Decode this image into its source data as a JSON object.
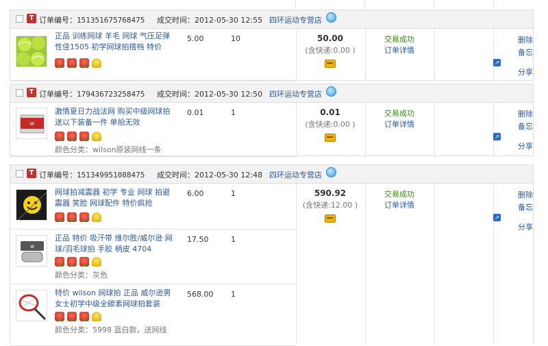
{
  "orders": [
    {
      "order_label": "订单编号：",
      "order_no": "151351675768475",
      "date_label": "成交时间：",
      "date": "2012-05-30 12:55",
      "shop": "四环运动专营店",
      "total": "50.00",
      "shipping": "(含快递:0.00 )",
      "status": "交易成功",
      "detail": "订单详情",
      "actions": {
        "delete": "删除",
        "memo": "备忘",
        "share": "分享"
      },
      "items": [
        {
          "title": "正品 训练网球 羊毛 网球 气压足弹性佳1505 初学网球拍搭档 特价",
          "price": "5.00",
          "qty": "10",
          "color": ""
        }
      ]
    },
    {
      "order_label": "订单编号：",
      "order_no": "179436723258475",
      "date_label": "成交时间：",
      "date": "2012-05-30 12:50",
      "shop": "四环运动专营店",
      "total": "0.01",
      "shipping": "(含快递:0.00 )",
      "status": "交易成功",
      "detail": "订单详情",
      "actions": {
        "delete": "删除",
        "memo": "备忘",
        "share": "分享"
      },
      "items": [
        {
          "title": "激情夏日力战法网 购买中级网球拍送以下装备一件 单拍无效",
          "price": "0.01",
          "qty": "1",
          "color": "颜色分类：wilson原装网线一条"
        }
      ]
    },
    {
      "order_label": "订单编号：",
      "order_no": "151349951088475",
      "date_label": "成交时间：",
      "date": "2012-05-30 12:48",
      "shop": "四环运动专营店",
      "total": "590.92",
      "shipping": "(含快递:12.00 )",
      "status": "交易成功",
      "detail": "订单详情",
      "actions": {
        "delete": "删除",
        "memo": "备忘",
        "share": "分享"
      },
      "items": [
        {
          "title": "网球拍减震器 初学 专业 网球 拍避震器 笑脸 网球配件 特价疯抢",
          "price": "6.00",
          "qty": "1",
          "color": ""
        },
        {
          "title": "正品 特价 吸汗带 维尔胜/威尔逊 网球/羽毛球拍 手胶 柄皮 4704",
          "price": "17.50",
          "qty": "1",
          "color": "颜色分类：灰色"
        },
        {
          "title": "特价 wilson 网球拍 正品 威尔逊男女士初学中级全碳素网球拍套装",
          "price": "568.00",
          "qty": "1",
          "color": "颜色分类：5998 蓝白款，送网线"
        }
      ]
    }
  ],
  "icon_names": [
    "rose-icon",
    "rose-icon",
    "rose-icon",
    "tulip-icon"
  ],
  "colors": {
    "link": "#2a58a8",
    "success": "#3a8a18",
    "badge": "#c9302c",
    "header_bg": "#f2f2f2"
  }
}
